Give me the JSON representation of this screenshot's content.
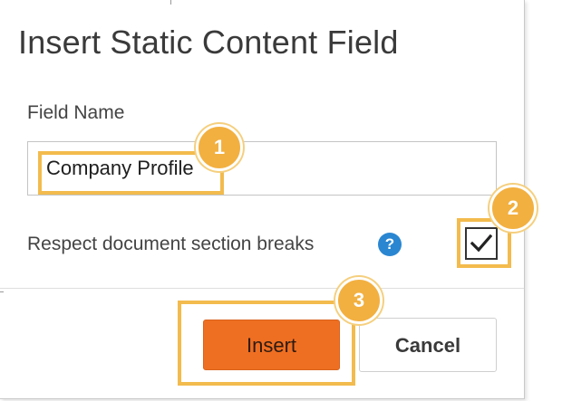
{
  "dialog": {
    "title": "Insert Static Content Field",
    "field_name_label": "Field Name",
    "field_name_value": "Company Profile",
    "respect_breaks_label": "Respect document section breaks",
    "respect_breaks_checked": true,
    "help_glyph": "?",
    "help_icon": "question-circle-icon",
    "insert_label": "Insert",
    "cancel_label": "Cancel"
  },
  "annotations": {
    "steps": [
      {
        "number": "1",
        "target": "field-name-input"
      },
      {
        "number": "2",
        "target": "respect-section-breaks-checkbox"
      },
      {
        "number": "3",
        "target": "insert-button"
      }
    ]
  },
  "colors": {
    "primary_button": "#ef6f22",
    "help_icon": "#2a86d1",
    "annotation": "#f2b040",
    "title_text": "#3a3a3a"
  }
}
